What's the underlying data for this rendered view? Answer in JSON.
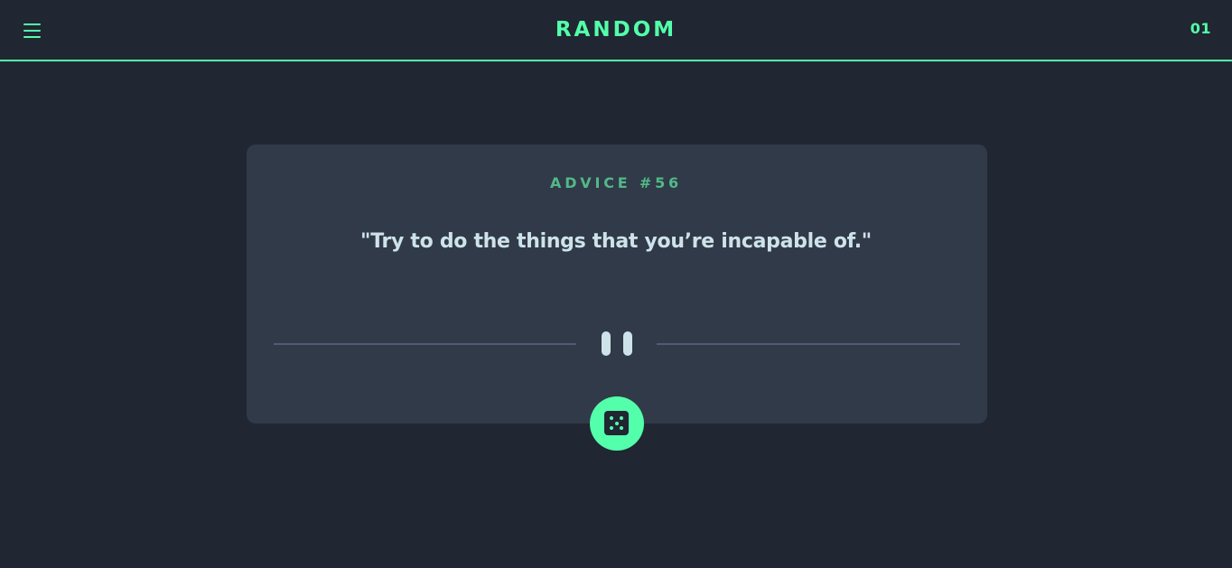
{
  "header": {
    "menu_icon": "hamburger-menu-icon",
    "title": "RANDOM",
    "counter": "01"
  },
  "card": {
    "advice_id": "ADVICE #56",
    "quote": "\"Try to do the things that you’re incapable of.\"",
    "divider_icon": "pause-icon"
  },
  "dice_button": {
    "icon": "dice-icon"
  },
  "colors": {
    "background": "#202632",
    "card": "#313a48",
    "accent": "#53ffaa",
    "advice_label": "#52b888",
    "quote_text": "#cee3e9",
    "divider": "#4f5d74"
  }
}
